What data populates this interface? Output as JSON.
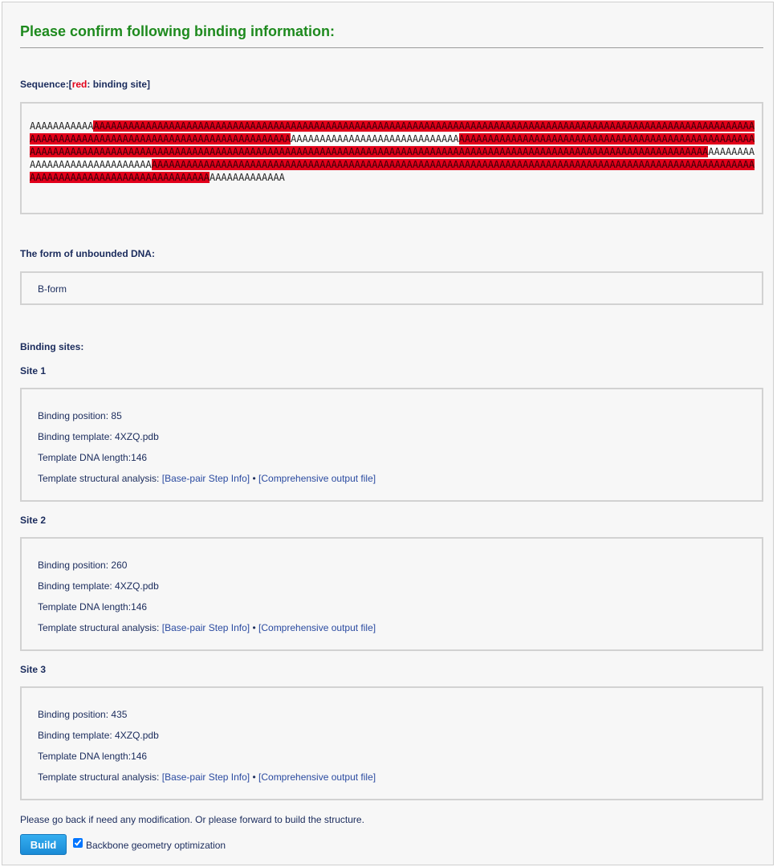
{
  "page": {
    "title": "Please confirm following binding information:"
  },
  "sequence": {
    "label_prefix": "Sequence:[",
    "label_red": "red",
    "label_suffix": ": binding site]",
    "segments": [
      {
        "type": "plain",
        "text": "AAAAAAAAAAA"
      },
      {
        "type": "red",
        "text": "AAAAAAAAAAAAAAAAAAAAAAAAAAAAAAAAAAAAAAAAAAAAAAAAAAAAAAAAAAAAAAAAAAAAAAAAAAAAAAAAAAAAAAAAAAAAAAAAAAAAAAAAAAAAAAAAAAAAAAAAAAAAAAAAAAAAAAAAAAAAAAAAAAAAAAAAAAAAAAA"
      },
      {
        "type": "white",
        "text": "AAAAAAAAAAAAAAAAAAAAAAAAAAAAA"
      },
      {
        "type": "red",
        "text": "AAAAAAAAAAAAAAAAAAAAAAAAAAAAAAAAAAAAAAAAAAAAAAAAAAAAAAAAAAAAAAAAAAAAAAAAAAAAAAAAAAAAAAAAAAAAAAAAAAAAAAAAAAAAAAAAAAAAAAAAAAAAAAAAAAAAAAAAAAAAAAAAAAAAAAAAAAAAAAAAAAAAAAAA"
      },
      {
        "type": "white",
        "text": "AAAAAAAAAAAAAAAAAAAAAAAAAAAAA"
      },
      {
        "type": "red",
        "text": "AAAAAAAAAAAAAAAAAAAAAAAAAAAAAAAAAAAAAAAAAAAAAAAAAAAAAAAAAAAAAAAAAAAAAAAAAAAAAAAAAAAAAAAAAAAAAAAAAAAAAAAAAAAAAAAAAAAAAAAAAAAAAAAAAAAAAAA"
      },
      {
        "type": "plain",
        "text": "AAAAAAAAAAAAA"
      }
    ]
  },
  "dna_form": {
    "label": "The form of unbounded DNA:",
    "value": "B-form"
  },
  "binding_sites_label": "Binding sites:",
  "sites": [
    {
      "title": "Site 1",
      "position": "Binding position: 85",
      "template": "Binding template: 4XZQ.pdb",
      "length": "Template DNA length:146",
      "analysis_prefix": "Template structural analysis: ",
      "link1": "[Base-pair Step Info]",
      "sep": " • ",
      "link2": "[Comprehensive output file]"
    },
    {
      "title": "Site 2",
      "position": "Binding position: 260",
      "template": "Binding template: 4XZQ.pdb",
      "length": "Template DNA length:146",
      "analysis_prefix": "Template structural analysis: ",
      "link1": "[Base-pair Step Info]",
      "sep": " • ",
      "link2": "[Comprehensive output file]"
    },
    {
      "title": "Site 3",
      "position": "Binding position: 435",
      "template": "Binding template: 4XZQ.pdb",
      "length": "Template DNA length:146",
      "analysis_prefix": "Template structural analysis: ",
      "link1": "[Base-pair Step Info]",
      "sep": " • ",
      "link2": "[Comprehensive output file]"
    }
  ],
  "footer": {
    "note": "Please go back if need any modification. Or please forward to build the structure.",
    "build_label": "Build",
    "checkbox_label": "Backbone geometry optimization",
    "checkbox_checked": true
  },
  "colors": {
    "title_green": "#1e8a1e",
    "binding_red": "#e2001a",
    "build_blue": "#1a8bd6"
  }
}
